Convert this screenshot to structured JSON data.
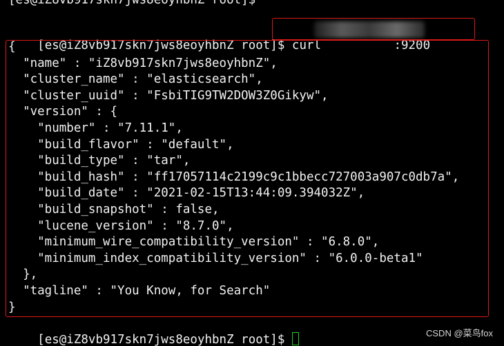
{
  "terminal": {
    "top_cropped_line": "[es@iZ8vb917skn7jws8eoyhbnZ root]$ ",
    "prompt": "[es@iZ8vb917skn7jws8eoyhbnZ root]$ ",
    "command_prefix": "curl ",
    "command_suffix": ":9200",
    "output_lines": [
      "{",
      "  \"name\" : \"iZ8vb917skn7jws8eoyhbnZ\",",
      "  \"cluster_name\" : \"elasticsearch\",",
      "  \"cluster_uuid\" : \"FsbiTIG9TW2DOW3Z0Gikyw\",",
      "  \"version\" : {",
      "    \"number\" : \"7.11.1\",",
      "    \"build_flavor\" : \"default\",",
      "    \"build_type\" : \"tar\",",
      "    \"build_hash\" : \"ff17057114c2199c9c1bbecc727003a907c0db7a\",",
      "    \"build_date\" : \"2021-02-15T13:44:09.394032Z\",",
      "    \"build_snapshot\" : false,",
      "    \"lucene_version\" : \"8.7.0\",",
      "    \"minimum_wire_compatibility_version\" : \"6.8.0\",",
      "    \"minimum_index_compatibility_version\" : \"6.0.0-beta1\"",
      "  },",
      "  \"tagline\" : \"You Know, for Search\"",
      "}"
    ],
    "final_prompt": "[es@iZ8vb917skn7jws8eoyhbnZ root]$ "
  },
  "watermark": "CSDN @菜鸟fox",
  "colors": {
    "background": "#000000",
    "text": "#f2f2f2",
    "highlight_border": "#e01818",
    "cursor": "#1fd11f"
  }
}
